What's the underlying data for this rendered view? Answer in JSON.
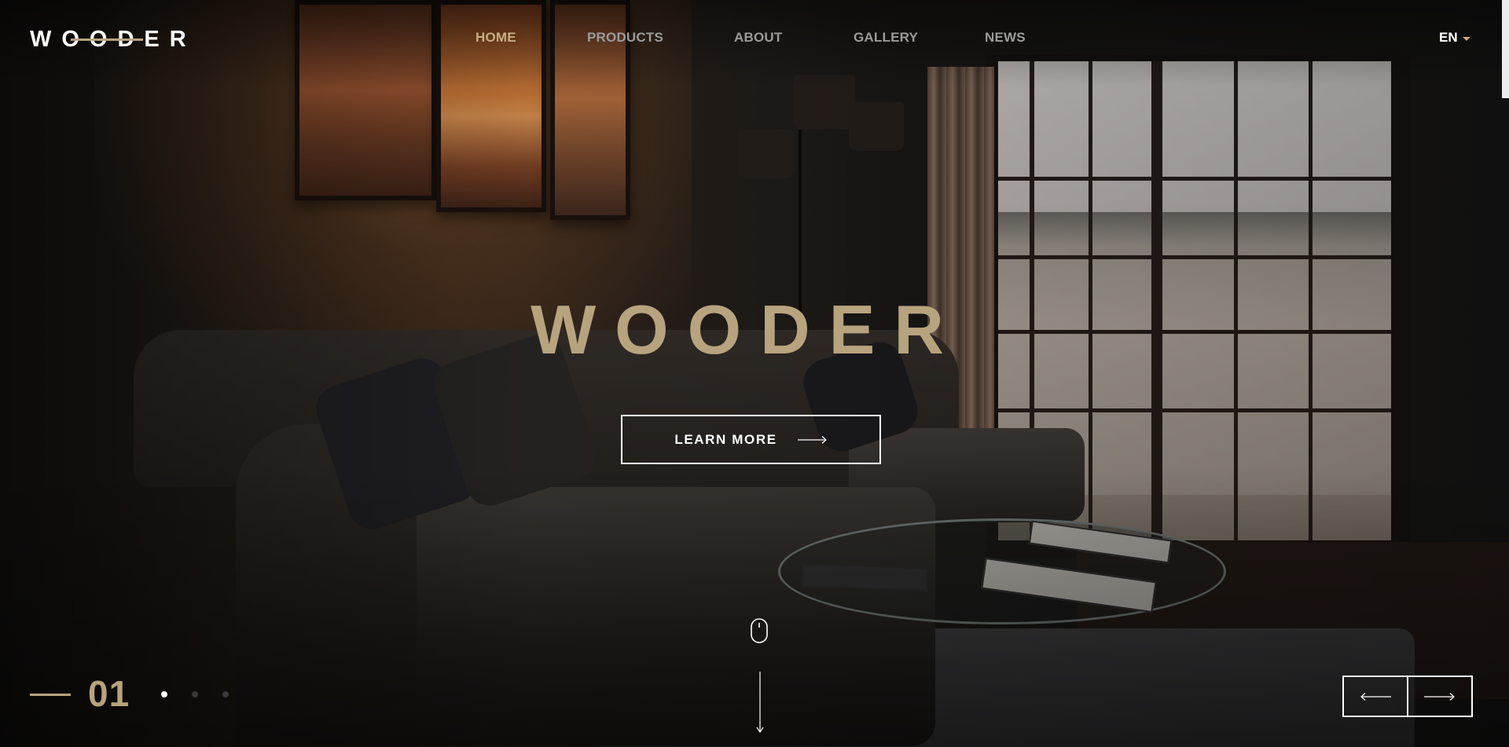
{
  "header": {
    "logo_text": "WOODER",
    "nav": [
      {
        "label": "HOME",
        "active": true
      },
      {
        "label": "PRODUCTS",
        "active": false
      },
      {
        "label": "ABOUT",
        "active": false
      },
      {
        "label": "GALLERY",
        "active": false
      },
      {
        "label": "NEWS",
        "active": false
      }
    ],
    "language": "EN"
  },
  "hero": {
    "title": "WOODER",
    "cta_label": "LEARN MORE",
    "cta_icon": "arrow-right-icon",
    "scroll_icon": "mouse-icon"
  },
  "slider": {
    "current": "01",
    "total_slides": 3,
    "active_index": 0,
    "prev_icon": "arrow-left-icon",
    "next_icon": "arrow-right-icon"
  },
  "colors": {
    "accent": "#b8a37f",
    "nav_active": "#c6ad82",
    "nav_inactive": "#9b9b9b",
    "text": "#ffffff",
    "background": "#141312"
  }
}
